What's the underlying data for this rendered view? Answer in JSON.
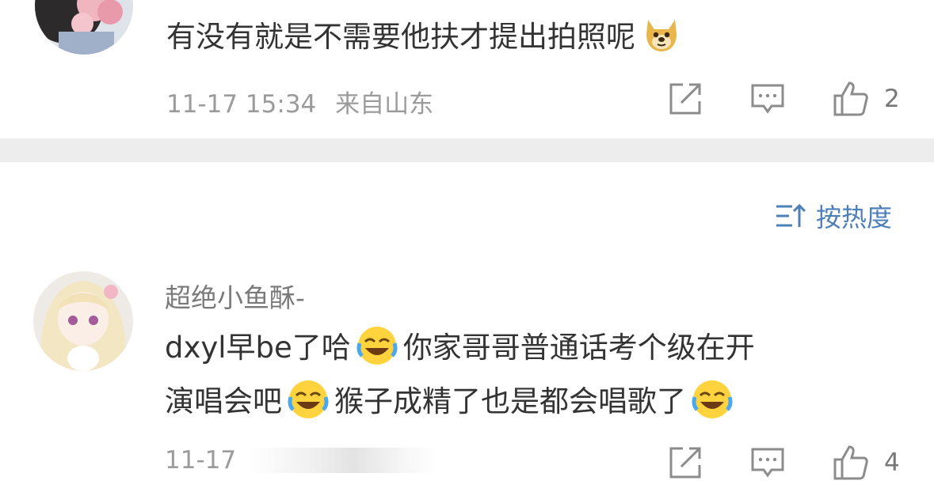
{
  "comment1": {
    "text": "有没有就是不需要他扶才提出拍照呢",
    "emoji_icon": "doge-icon",
    "timestamp": "11-17 15:34",
    "location": "来自山东",
    "like_count": "2"
  },
  "sort": {
    "label": "按热度",
    "icon": "sort-icon"
  },
  "comment2": {
    "username": "超绝小鱼酥-",
    "text_parts": [
      "dxyl早be了哈",
      "你家哥哥普通话考个级在开",
      "演唱会吧",
      "猴子成精了也是都会唱歌了"
    ],
    "emoji_icon": "laugh-cry-icon",
    "timestamp": "11-17",
    "like_count": "4"
  },
  "colors": {
    "text": "#333333",
    "meta": "#9b9b9b",
    "accent": "#4d7fb8",
    "divider": "#ededed"
  }
}
